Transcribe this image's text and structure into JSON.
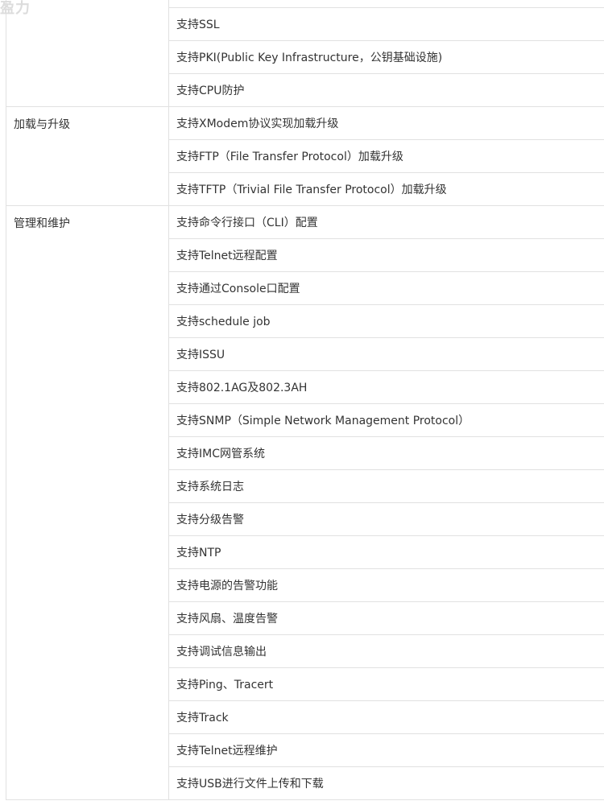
{
  "watermark": "盈力",
  "table": {
    "groups": [
      {
        "category": "",
        "features": [
          "",
          "支持SSL",
          "支持PKI(Public Key Infrastructure，公钥基础设施)",
          "支持CPU防护"
        ]
      },
      {
        "category": "加载与升级",
        "features": [
          "支持XModem协议实现加载升级",
          "支持FTP（File Transfer Protocol）加载升级",
          "支持TFTP（Trivial File Transfer Protocol）加载升级"
        ]
      },
      {
        "category": "管理和维护",
        "features": [
          "支持命令行接口（CLI）配置",
          "支持Telnet远程配置",
          "支持通过Console口配置",
          "支持schedule job",
          "支持ISSU",
          "支持802.1AG及802.3AH",
          "支持SNMP（Simple Network Management Protocol）",
          "支持IMC网管系统",
          "支持系统日志",
          "支持分级告警",
          "支持NTP",
          "支持电源的告警功能",
          "支持风扇、温度告警",
          "支持调试信息输出",
          "支持Ping、Tracert",
          "支持Track",
          "支持Telnet远程维护",
          "支持USB进行文件上传和下载"
        ]
      }
    ]
  }
}
